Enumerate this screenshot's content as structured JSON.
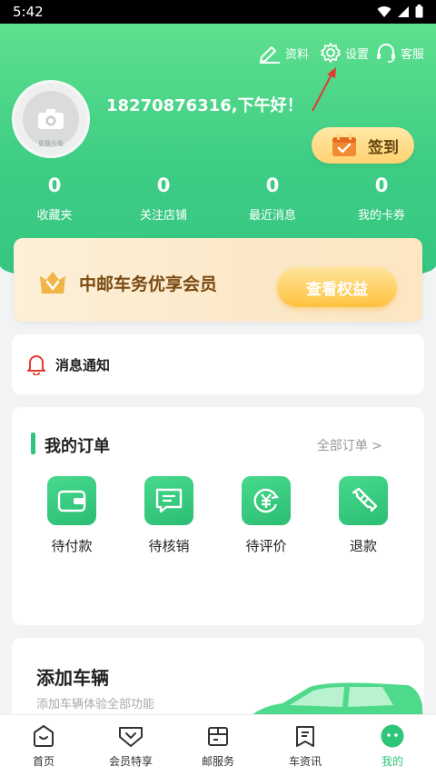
{
  "status_bar": {
    "time": "5:42"
  },
  "header": {
    "profile_label": "资料",
    "settings_label": "设置",
    "service_label": "客服",
    "greeting": "18270876316,下午好！",
    "avatar_hint": "更换头像",
    "signin_label": "签到"
  },
  "stats": [
    {
      "value": "0",
      "label": "收藏夹"
    },
    {
      "value": "0",
      "label": "关注店铺"
    },
    {
      "value": "0",
      "label": "最近消息"
    },
    {
      "value": "0",
      "label": "我的卡券"
    }
  ],
  "vip": {
    "title": "中邮车务优享会员",
    "button": "查看权益"
  },
  "notice": {
    "label": "消息通知"
  },
  "orders": {
    "title": "我的订单",
    "all_link": "全部订单 >",
    "items": [
      {
        "label": "待付款",
        "icon": "wallet-icon"
      },
      {
        "label": "待核销",
        "icon": "message-box-icon"
      },
      {
        "label": "待评价",
        "icon": "yuan-refresh-icon"
      },
      {
        "label": "退款",
        "icon": "ticket-icon"
      }
    ]
  },
  "vehicle": {
    "title": "添加车辆",
    "subtitle": "添加车辆体验全部功能"
  },
  "tabs": [
    {
      "label": "首页",
      "icon": "home-icon"
    },
    {
      "label": "会员特享",
      "icon": "member-icon"
    },
    {
      "label": "邮服务",
      "icon": "box-icon"
    },
    {
      "label": "车资讯",
      "icon": "news-icon"
    },
    {
      "label": "我的",
      "icon": "profile-icon",
      "active": true
    }
  ],
  "colors": {
    "brand_green": "#2ec479",
    "header_green": "#4fd78a",
    "gold": "#ffc23f",
    "alert_red": "#e23a32"
  }
}
